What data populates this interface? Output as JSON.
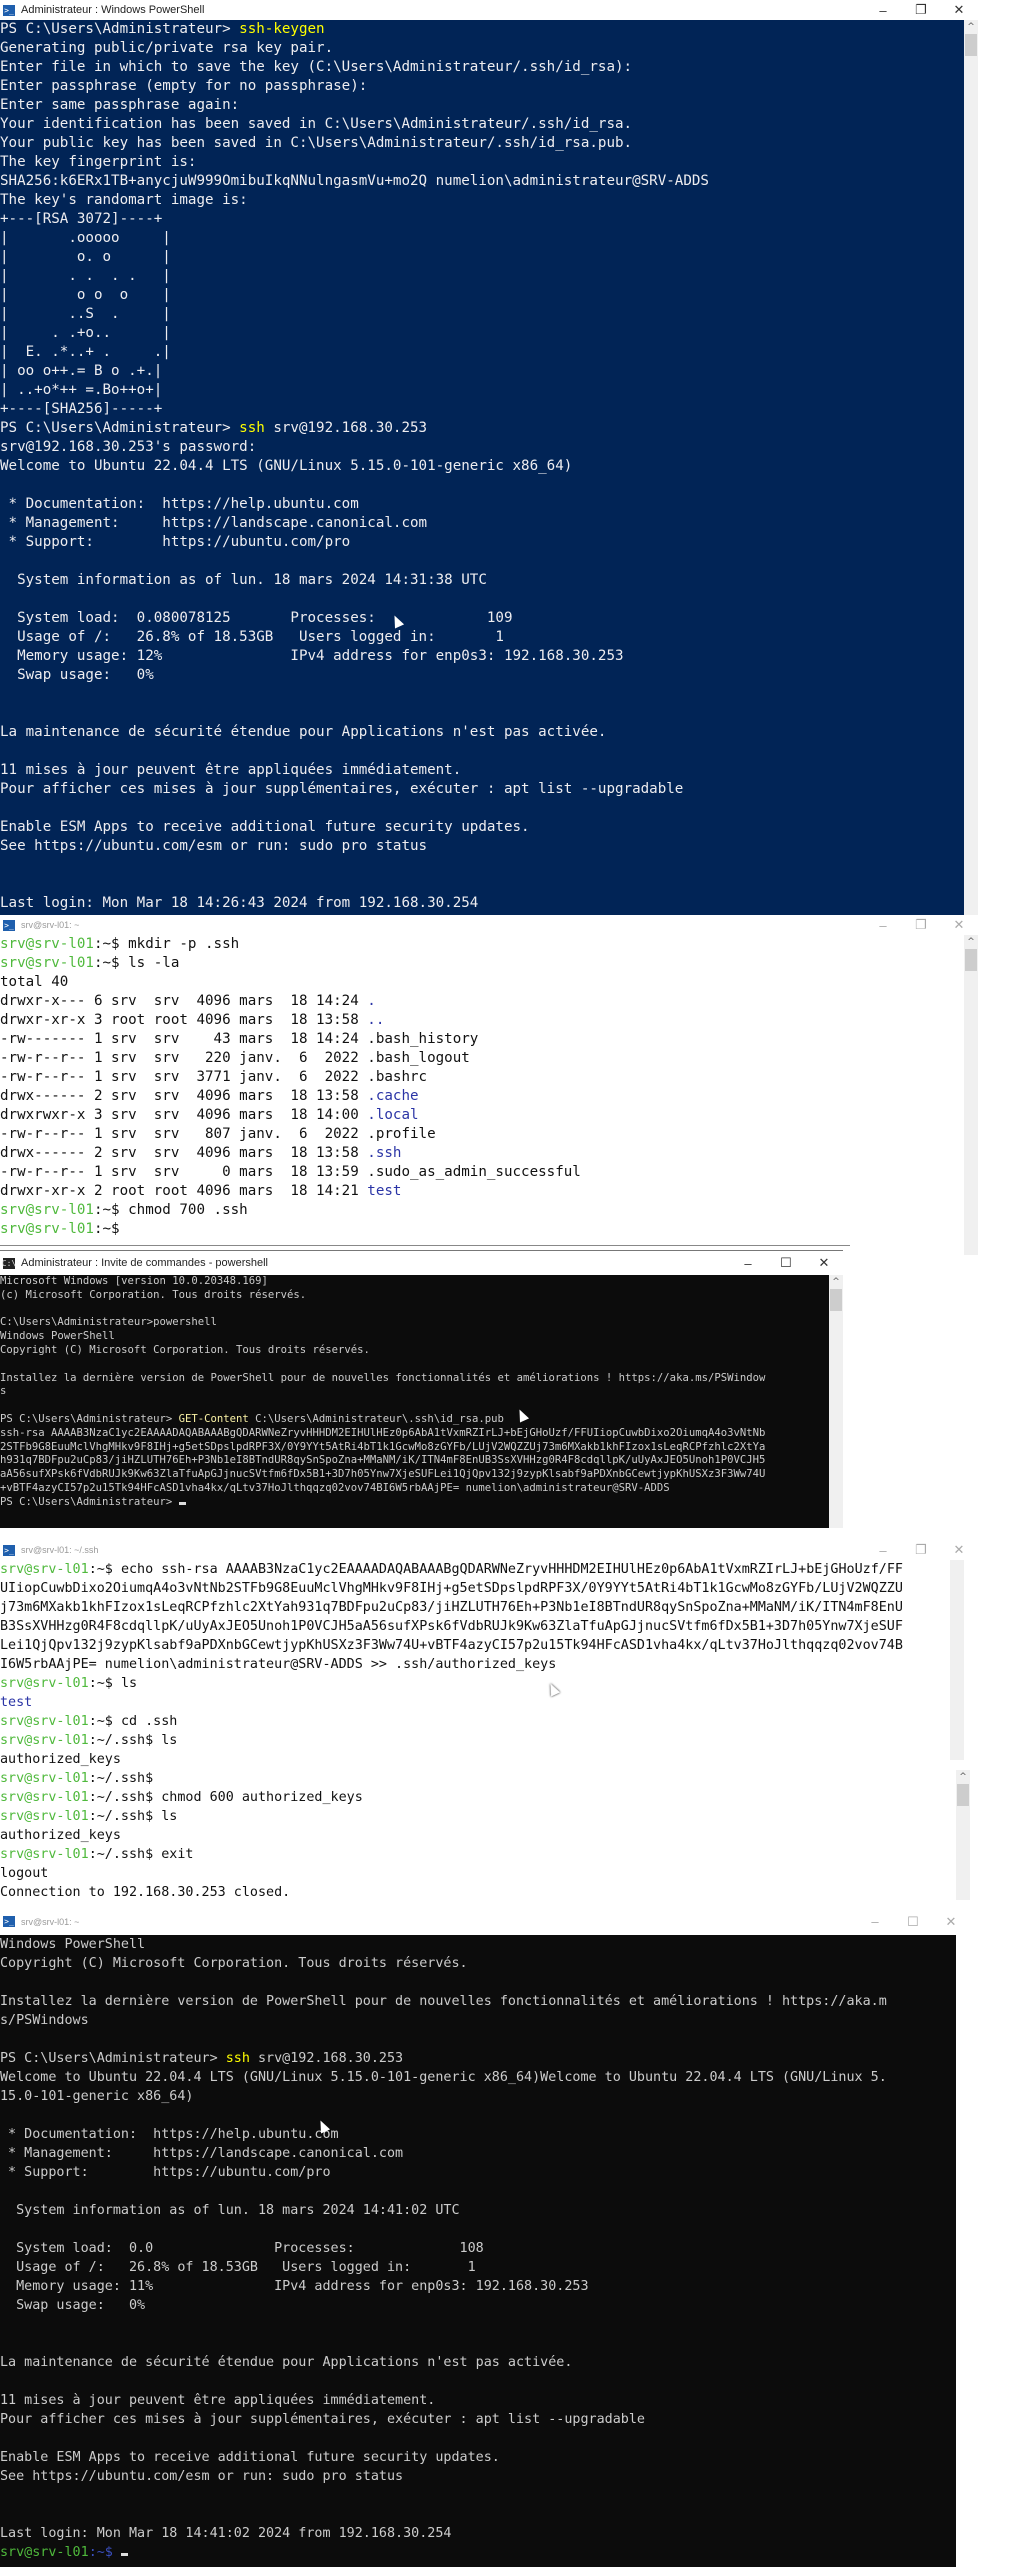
{
  "windows": {
    "w1": {
      "title": "Administrateur : Windows PowerShell",
      "icon": "powershell-icon",
      "buttons": {
        "minimize": "–",
        "restore": "❐",
        "close": "✕"
      },
      "lines": [
        {
          "prompt": "PS C:\\Users\\Administrateur> ",
          "cmd": "ssh-keygen"
        },
        {
          "text": "Generating public/private rsa key pair."
        },
        {
          "text": "Enter file in which to save the key (C:\\Users\\Administrateur/.ssh/id_rsa):"
        },
        {
          "text": "Enter passphrase (empty for no passphrase):"
        },
        {
          "text": "Enter same passphrase again:"
        },
        {
          "text": "Your identification has been saved in C:\\Users\\Administrateur/.ssh/id_rsa."
        },
        {
          "text": "Your public key has been saved in C:\\Users\\Administrateur/.ssh/id_rsa.pub."
        },
        {
          "text": "The key fingerprint is:"
        },
        {
          "text": "SHA256:k6ERx1TB+anycjuW999OmibuIkqNNulngasmVu+mo2Q numelion\\administrateur@SRV-ADDS"
        },
        {
          "text": "The key's randomart image is:"
        },
        {
          "text": "+---[RSA 3072]----+"
        },
        {
          "text": "|       .ooooo     |"
        },
        {
          "text": "|        o. o      |"
        },
        {
          "text": "|       . .  . .   |"
        },
        {
          "text": "|        o o  o    |"
        },
        {
          "text": "|       ..S  .     |"
        },
        {
          "text": "|     . .+o..      |"
        },
        {
          "text": "|  E. .*..+ .     .|"
        },
        {
          "text": "| oo o++.= B o .+.|"
        },
        {
          "text": "| ..+o*++ =.Bo++o+|"
        },
        {
          "text": "+----[SHA256]-----+"
        },
        {
          "prompt": "PS C:\\Users\\Administrateur> ",
          "cmd": "ssh",
          "rest": " srv@192.168.30.253"
        },
        {
          "text": "srv@192.168.30.253's password:"
        },
        {
          "text": "Welcome to Ubuntu 22.04.4 LTS (GNU/Linux 5.15.0-101-generic x86_64)"
        },
        {
          "text": ""
        },
        {
          "text": " * Documentation:  https://help.ubuntu.com"
        },
        {
          "text": " * Management:     https://landscape.canonical.com"
        },
        {
          "text": " * Support:        https://ubuntu.com/pro"
        },
        {
          "text": ""
        },
        {
          "text": "  System information as of lun. 18 mars 2024 14:31:38 UTC"
        },
        {
          "text": ""
        },
        {
          "text": "  System load:  0.080078125       Processes:             109"
        },
        {
          "text": "  Usage of /:   26.8% of 18.53GB   Users logged in:       1"
        },
        {
          "text": "  Memory usage: 12%               IPv4 address for enp0s3: 192.168.30.253"
        },
        {
          "text": "  Swap usage:   0%"
        },
        {
          "text": ""
        },
        {
          "text": ""
        },
        {
          "text": "La maintenance de sécurité étendue pour Applications n'est pas activée."
        },
        {
          "text": ""
        },
        {
          "text": "11 mises à jour peuvent être appliquées immédiatement."
        },
        {
          "text": "Pour afficher ces mises à jour supplémentaires, exécuter : apt list --upgradable"
        },
        {
          "text": ""
        },
        {
          "text": "Enable ESM Apps to receive additional future security updates."
        },
        {
          "text": "See https://ubuntu.com/esm or run: sudo pro status"
        },
        {
          "text": ""
        },
        {
          "text": ""
        },
        {
          "text": "Last login: Mon Mar 18 14:26:43 2024 from 192.168.30.254"
        }
      ]
    },
    "w2": {
      "title": "srv@srv-l01: ~",
      "icon": "powershell-icon",
      "buttons": {
        "minimize": "–",
        "restore": "❐",
        "close": "✕"
      },
      "prompt_user": "srv@srv-l01",
      "prompt_path_home": ":~$ ",
      "lines": [
        {
          "type": "prompt",
          "cmd": "mkdir -p .ssh"
        },
        {
          "type": "prompt",
          "cmd": "ls -la"
        },
        {
          "type": "text",
          "text": "total 40"
        },
        {
          "type": "ls",
          "text": "drwxr-x--- 6 srv  srv  4096 mars  18 14:24 ",
          "name": ".",
          "dir": true
        },
        {
          "type": "ls",
          "text": "drwxr-xr-x 3 root root 4096 mars  18 13:58 ",
          "name": "..",
          "dir": true
        },
        {
          "type": "ls",
          "text": "-rw------- 1 srv  srv    43 mars  18 14:24 ",
          "name": ".bash_history",
          "dir": false
        },
        {
          "type": "ls",
          "text": "-rw-r--r-- 1 srv  srv   220 janv.  6  2022 ",
          "name": ".bash_logout",
          "dir": false
        },
        {
          "type": "ls",
          "text": "-rw-r--r-- 1 srv  srv  3771 janv.  6  2022 ",
          "name": ".bashrc",
          "dir": false
        },
        {
          "type": "ls",
          "text": "drwx------ 2 srv  srv  4096 mars  18 13:58 ",
          "name": ".cache",
          "dir": true
        },
        {
          "type": "ls",
          "text": "drwxrwxr-x 3 srv  srv  4096 mars  18 14:00 ",
          "name": ".local",
          "dir": true
        },
        {
          "type": "ls",
          "text": "-rw-r--r-- 1 srv  srv   807 janv.  6  2022 ",
          "name": ".profile",
          "dir": false
        },
        {
          "type": "ls",
          "text": "drwx------ 2 srv  srv  4096 mars  18 13:58 ",
          "name": ".ssh",
          "dir": true
        },
        {
          "type": "ls",
          "text": "-rw-r--r-- 1 srv  srv     0 mars  18 13:59 ",
          "name": ".sudo_as_admin_successful",
          "dir": false
        },
        {
          "type": "ls",
          "text": "drwxr-xr-x 2 root root 4096 mars  18 14:21 ",
          "name": "test",
          "dir": true
        },
        {
          "type": "prompt",
          "cmd": "chmod 700 .ssh"
        },
        {
          "type": "prompt",
          "cmd": ""
        }
      ]
    },
    "w3": {
      "title": "Administrateur : Invite de commandes - powershell",
      "icon": "cmd-icon",
      "buttons": {
        "minimize": "–",
        "maximize": "☐",
        "close": "✕"
      },
      "lines": [
        {
          "text": "Microsoft Windows [version 10.0.20348.169]"
        },
        {
          "text": "(c) Microsoft Corporation. Tous droits réservés."
        },
        {
          "text": ""
        },
        {
          "text": "C:\\Users\\Administrateur>powershell"
        },
        {
          "text": "Windows PowerShell"
        },
        {
          "text": "Copyright (C) Microsoft Corporation. Tous droits réservés."
        },
        {
          "text": ""
        },
        {
          "text": "Installez la dernière version de PowerShell pour de nouvelles fonctionnalités et améliorations ! https://aka.ms/PSWindow"
        },
        {
          "text": "s"
        },
        {
          "text": ""
        },
        {
          "prompt": "PS C:\\Users\\Administrateur> ",
          "cmd": "GET-Content",
          "rest": " C:\\Users\\Administrateur\\.ssh\\id_rsa.pub"
        },
        {
          "text": "ssh-rsa AAAAB3NzaC1yc2EAAAADAQABAAABgQDARWNeZryvHHHDM2EIHUlHEz0p6AbA1tVxmRZIrLJ+bEjGHoUzf/FFUIiopCuwbDixo2OiumqA4o3vNtNb"
        },
        {
          "text": "2STFb9G8EuuMclVhgMHkv9F8IHj+g5etSDpslpdRPF3X/0Y9YYt5AtRi4bT1k1GcwMo8zGYFb/LUjV2WQZZUj73m6MXakb1khFIzox1sLeqRCPfzhlc2XtYa"
        },
        {
          "text": "h931q7BDFpu2uCp83/jiHZLUTH76Eh+P3Nb1eI8BTndUR8qySnSpoZna+MMaNM/iK/ITN4mF8EnUB3SsXVHHzg0R4F8cdqllpK/uUyAxJEO5Unoh1P0VCJH5"
        },
        {
          "text": "aA56sufXPsk6fVdbRUJk9Kw63ZlaTfuApGJjnucSVtfm6fDx5B1+3D7h05Ynw7XjeSUFLei1QjQpv132j9zypKlsabf9aPDXnbGCewtjypKhUSXz3F3Ww74U"
        },
        {
          "text": "+vBTF4azyCI57p2u15Tk94HFcASD1vha4kx/qLtv37HoJlthqqzq02vov74BI6W5rbAAjPE= numelion\\administrateur@SRV-ADDS"
        },
        {
          "prompt": "PS C:\\Users\\Administrateur> ",
          "cmd": "",
          "rest": "",
          "cursor": true
        }
      ]
    },
    "w4": {
      "title": "srv@srv-l01: ~/.ssh",
      "icon": "powershell-icon",
      "buttons": {
        "minimize": "–",
        "restore": "❐",
        "close": "✕"
      },
      "prompt_user": "srv@srv-l01",
      "lines": [
        {
          "type": "prompt",
          "path": ":~$ ",
          "cmd": "echo ssh-rsa AAAAB3NzaC1yc2EAAAADAQABAAABgQDARWNeZryvHHHDM2EIHUlHEz0p6AbA1tVxmRZIrLJ+bEjGHoUzf/FF"
        },
        {
          "type": "text",
          "text": "UIiopCuwbDixo2OiumqA4o3vNtNb2STFb9G8EuuMclVhgMHkv9F8IHj+g5etSDpslpdRPF3X/0Y9YYt5AtRi4bT1k1GcwMo8zGYFb/LUjV2WQZZU"
        },
        {
          "type": "text",
          "text": "j73m6MXakb1khFIzox1sLeqRCPfzhlc2XtYah931q7BDFpu2uCp83/jiHZLUTH76Eh+P3Nb1eI8BTndUR8qySnSpoZna+MMaNM/iK/ITN4mF8EnU"
        },
        {
          "type": "text",
          "text": "B3SsXVHHzg0R4F8cdqllpK/uUyAxJEO5Unoh1P0VCJH5aA56sufXPsk6fVdbRUJk9Kw63ZlaTfuApGJjnucSVtfm6fDx5B1+3D7h05Ynw7XjeSUF"
        },
        {
          "type": "text",
          "text": "Lei1QjQpv132j9zypKlsabf9aPDXnbGCewtjypKhUSXz3F3Ww74U+vBTF4azyCI57p2u15Tk94HFcASD1vha4kx/qLtv37HoJlthqqzq02vov74B"
        },
        {
          "type": "text",
          "text": "I6W5rbAAjPE= numelion\\administrateur@SRV-ADDS >> .ssh/authorized_keys"
        },
        {
          "type": "prompt",
          "path": ":~$ ",
          "cmd": "ls"
        },
        {
          "type": "dir",
          "text": "test"
        },
        {
          "type": "prompt",
          "path": ":~$ ",
          "cmd": "cd .ssh"
        },
        {
          "type": "prompt",
          "path": ":~/.ssh$ ",
          "cmd": "ls"
        },
        {
          "type": "text",
          "text": "authorized_keys"
        },
        {
          "type": "prompt",
          "path": ":~/.ssh$ ",
          "cmd": ""
        },
        {
          "type": "prompt",
          "path": ":~/.ssh$ ",
          "cmd": "chmod 600 authorized_keys"
        },
        {
          "type": "prompt",
          "path": ":~/.ssh$ ",
          "cmd": "ls"
        },
        {
          "type": "text",
          "text": "authorized_keys"
        },
        {
          "type": "prompt",
          "path": ":~/.ssh$ ",
          "cmd": "exit"
        },
        {
          "type": "text",
          "text": "logout"
        },
        {
          "type": "text",
          "text": "Connection to 192.168.30.253 closed."
        }
      ]
    },
    "w5": {
      "title": "srv@srv-l01: ~",
      "icon": "powershell-icon",
      "buttons": {
        "minimize": "–",
        "maximize": "☐",
        "close": "✕"
      },
      "lines": [
        {
          "text": "Windows PowerShell"
        },
        {
          "text": "Copyright (C) Microsoft Corporation. Tous droits réservés."
        },
        {
          "text": ""
        },
        {
          "text": "Installez la dernière version de PowerShell pour de nouvelles fonctionnalités et améliorations ! https://aka.m"
        },
        {
          "text": "s/PSWindows"
        },
        {
          "text": ""
        },
        {
          "prompt": "PS C:\\Users\\Administrateur> ",
          "cmd": "ssh",
          "rest": " srv@192.168.30.253"
        },
        {
          "text": "Welcome to Ubuntu 22.04.4 LTS (GNU/Linux 5.15.0-101-generic x86_64)Welcome to Ubuntu 22.04.4 LTS (GNU/Linux 5."
        },
        {
          "text": "15.0-101-generic x86_64)"
        },
        {
          "text": ""
        },
        {
          "text": " * Documentation:  https://help.ubuntu.com"
        },
        {
          "text": " * Management:     https://landscape.canonical.com"
        },
        {
          "text": " * Support:        https://ubuntu.com/pro"
        },
        {
          "text": ""
        },
        {
          "text": "  System information as of lun. 18 mars 2024 14:41:02 UTC"
        },
        {
          "text": ""
        },
        {
          "text": "  System load:  0.0               Processes:             108"
        },
        {
          "text": "  Usage of /:   26.8% of 18.53GB   Users logged in:       1"
        },
        {
          "text": "  Memory usage: 11%               IPv4 address for enp0s3: 192.168.30.253"
        },
        {
          "text": "  Swap usage:   0%"
        },
        {
          "text": ""
        },
        {
          "text": ""
        },
        {
          "text": "La maintenance de sécurité étendue pour Applications n'est pas activée."
        },
        {
          "text": ""
        },
        {
          "text": "11 mises à jour peuvent être appliquées immédiatement."
        },
        {
          "text": "Pour afficher ces mises à jour supplémentaires, exécuter : apt list --upgradable"
        },
        {
          "text": ""
        },
        {
          "text": "Enable ESM Apps to receive additional future security updates."
        },
        {
          "text": "See https://ubuntu.com/esm or run: sudo pro status"
        },
        {
          "text": ""
        },
        {
          "text": ""
        },
        {
          "text": "Last login: Mon Mar 18 14:41:02 2024 from 192.168.30.254"
        },
        {
          "user": "srv@srv-l01",
          "path": ":~$ ",
          "cursor": true
        }
      ]
    }
  },
  "scrollbar": {
    "up_arrow": "^"
  },
  "colors": {
    "powershell_blue": "#012456",
    "console_black": "#0c0c0c",
    "command_yellow": "#ffff00",
    "prompt_green": "#4fb93c",
    "path_blue": "#2b35a6"
  }
}
